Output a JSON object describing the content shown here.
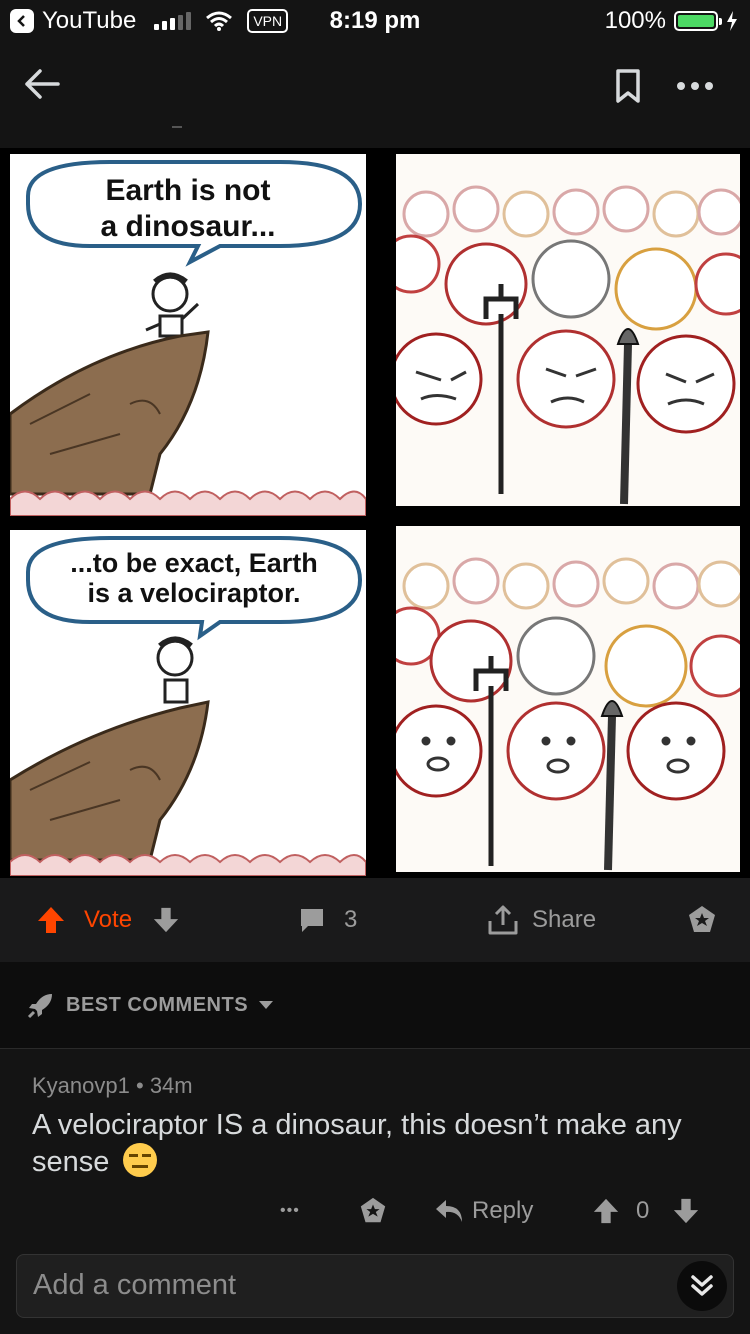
{
  "status_bar": {
    "back_app": "YouTube",
    "vpn": "VPN",
    "time": "8:19 pm",
    "battery": "100%"
  },
  "comic": {
    "panel1_text_line1": "Earth is not",
    "panel1_text_line2": "a dinosaur...",
    "panel3_text_line1": "...to be exact, Earth",
    "panel3_text_line2": "is a velociraptor."
  },
  "actions": {
    "vote_label": "Vote",
    "comment_count": "3",
    "share_label": "Share"
  },
  "sort": {
    "label": "BEST COMMENTS"
  },
  "comment": {
    "author": "Kyanovp1",
    "separator": "•",
    "age": "34m",
    "body": "A velociraptor IS a dinosaur, this doesn’t make any sense",
    "emoji": "expressionless-face",
    "more": "•••",
    "reply_label": "Reply",
    "score": "0"
  },
  "footer": {
    "add_comment_placeholder": "Add a comment"
  },
  "colors": {
    "accent_upvote": "#ff4500",
    "battery_green": "#4cd964",
    "background": "#141414"
  }
}
